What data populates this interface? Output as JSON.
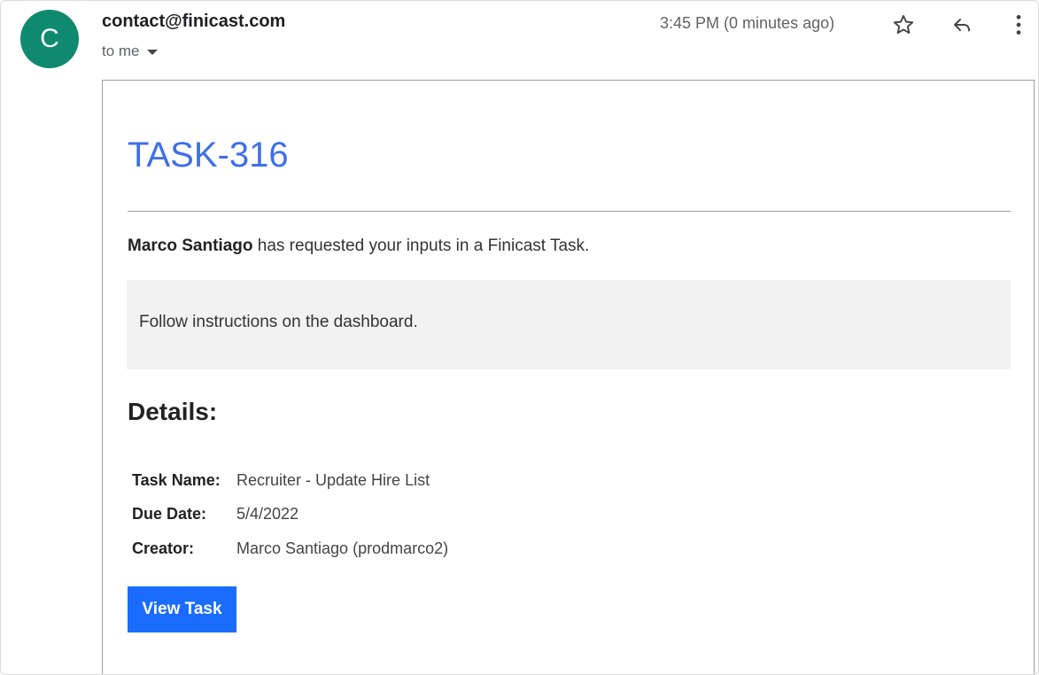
{
  "header": {
    "avatar_letter": "C",
    "avatar_color": "#0f8a6e",
    "sender": "contact@finicast.com",
    "recipient": "to me",
    "timestamp": "3:45 PM (0 minutes ago)",
    "icons": [
      "star-icon",
      "reply-icon",
      "more-vert-icon"
    ]
  },
  "email": {
    "task_id": "TASK-316",
    "requester": "Marco Santiago",
    "request_text": " has requested your inputs in a Finicast Task.",
    "instructions": "Follow instructions on the dashboard.",
    "details_heading": "Details:",
    "details": [
      {
        "key": "Task Name:",
        "value": "Recruiter - Update Hire List"
      },
      {
        "key": "Due Date:",
        "value": "5/4/2022"
      },
      {
        "key": "Creator:",
        "value": "Marco Santiago (prodmarco2)"
      }
    ],
    "button_label": "View Task",
    "accent_color": "#3f6fe8",
    "button_color": "#1a6cff"
  }
}
